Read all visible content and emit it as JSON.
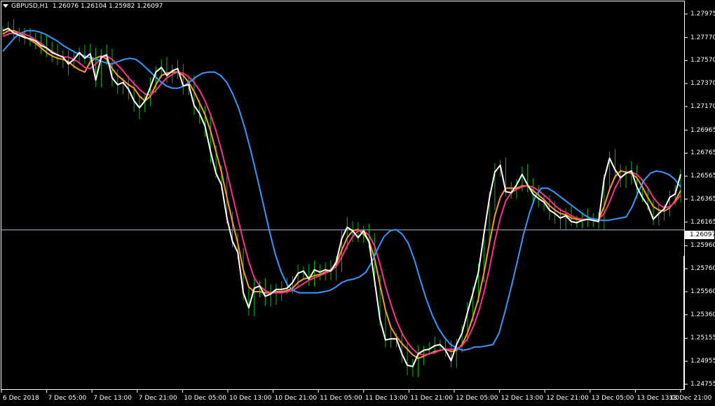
{
  "header": {
    "symbol": "GBPUSD,H1",
    "open": "1.26076",
    "high": "1.26104",
    "low": "1.25982",
    "close": "1.26097"
  },
  "current_price_label": "1.26097",
  "colors": {
    "background": "#000000",
    "grid_frame": "#ffffff",
    "bars": "#00c000",
    "price_line": "#ffffff",
    "ma_orange": "#ff9a1a",
    "ma_pink": "#ff2f8e",
    "ma_blue": "#3399ff",
    "bid_line": "#b0c4de"
  },
  "y_axis_ticks": [
    "1.27975",
    "1.27770",
    "1.27570",
    "1.27370",
    "1.27170",
    "1.26965",
    "1.26765",
    "1.26565",
    "1.26365",
    "1.26165",
    "1.25960",
    "1.25760",
    "1.25560",
    "1.25360",
    "1.25155",
    "1.24955",
    "1.24755"
  ],
  "x_axis_ticks": [
    "6 Dec 2018",
    "7 Dec 05:00",
    "7 Dec 13:00",
    "7 Dec 21:00",
    "10 Dec 05:00",
    "10 Dec 13:00",
    "10 Dec 21:00",
    "11 Dec 05:00",
    "11 Dec 13:00",
    "11 Dec 21:00",
    "12 Dec 05:00",
    "12 Dec 13:00",
    "12 Dec 21:00",
    "13 Dec 05:00",
    "13 Dec 13:00",
    "13 Dec 21:00"
  ],
  "chart_data": {
    "type": "line",
    "title": "GBPUSD,H1",
    "ylim": [
      1.247,
      1.2806
    ],
    "current_price": 1.26097,
    "series": [
      {
        "values": [
          1.2783,
          1.2785,
          1.2781,
          1.2779,
          1.2777,
          1.2776,
          1.2774,
          1.277,
          1.2768,
          1.2764,
          1.2762,
          1.276,
          1.2754,
          1.2758,
          1.2764,
          1.2759,
          1.2763,
          1.274,
          1.276,
          1.2762,
          1.2742,
          1.2736,
          1.2738,
          1.2732,
          1.2722,
          1.2716,
          1.2722,
          1.2734,
          1.2747,
          1.2751,
          1.2744,
          1.2748,
          1.275,
          1.2735,
          1.2736,
          1.2718,
          1.2711,
          1.27,
          1.2678,
          1.2659,
          1.2649,
          1.262,
          1.26,
          1.259,
          1.2555,
          1.2542,
          1.2559,
          1.2561,
          1.2552,
          1.2554,
          1.2558,
          1.2558,
          1.2559,
          1.2564,
          1.2572,
          1.2574,
          1.2567,
          1.2575,
          1.2573,
          1.2575,
          1.2574,
          1.2582,
          1.2602,
          1.2612,
          1.2609,
          1.2603,
          1.2609,
          1.2599,
          1.2566,
          1.2532,
          1.2514,
          1.2515,
          1.2515,
          1.2502,
          1.2492,
          1.2491,
          1.2502,
          1.2505,
          1.2506,
          1.2509,
          1.251,
          1.2505,
          1.2496,
          1.251,
          1.252,
          1.2538,
          1.2555,
          1.2573,
          1.2606,
          1.2637,
          1.266,
          1.2666,
          1.2643,
          1.2642,
          1.2649,
          1.2658,
          1.2649,
          1.2641,
          1.2637,
          1.2634,
          1.2627,
          1.2624,
          1.262,
          1.2622,
          1.2617,
          1.2616,
          1.2618,
          1.2619,
          1.2618,
          1.2617,
          1.2654,
          1.2672,
          1.2662,
          1.2655,
          1.2659,
          1.2661,
          1.2647,
          1.2638,
          1.2631,
          1.2619,
          1.2624,
          1.2628,
          1.2638,
          1.2641,
          1.2658
        ]
      },
      {
        "values": [
          1.278,
          1.2783,
          1.2783,
          1.2781,
          1.2778,
          1.2775,
          1.2772,
          1.2768,
          1.2764,
          1.2761,
          1.2759,
          1.2758,
          1.2756,
          1.2752,
          1.2749,
          1.2747,
          1.2756,
          1.2759,
          1.2761,
          1.2758,
          1.275,
          1.2744,
          1.274,
          1.2736,
          1.2733,
          1.2726,
          1.2722,
          1.2726,
          1.2736,
          1.2744,
          1.2746,
          1.2747,
          1.2747,
          1.2744,
          1.2738,
          1.273,
          1.272,
          1.271,
          1.2696,
          1.2678,
          1.266,
          1.2638,
          1.2617,
          1.2598,
          1.2575,
          1.256,
          1.2556,
          1.2556,
          1.2555,
          1.2555,
          1.2556,
          1.2556,
          1.2557,
          1.2559,
          1.2564,
          1.2567,
          1.2568,
          1.257,
          1.2571,
          1.2573,
          1.2575,
          1.258,
          1.2592,
          1.2603,
          1.2609,
          1.261,
          1.2606,
          1.26,
          1.2585,
          1.2562,
          1.254,
          1.2525,
          1.2517,
          1.2511,
          1.2506,
          1.2501,
          1.2498,
          1.25,
          1.2502,
          1.2504,
          1.2505,
          1.2506,
          1.2504,
          1.2505,
          1.251,
          1.252,
          1.2534,
          1.255,
          1.2572,
          1.2598,
          1.2622,
          1.2638,
          1.2646,
          1.2646,
          1.2646,
          1.2648,
          1.2648,
          1.2644,
          1.264,
          1.2636,
          1.2631,
          1.2627,
          1.2624,
          1.2623,
          1.262,
          1.2619,
          1.2618,
          1.2619,
          1.2619,
          1.2619,
          1.263,
          1.2645,
          1.2656,
          1.2661,
          1.266,
          1.2659,
          1.2655,
          1.2647,
          1.2638,
          1.263,
          1.2627,
          1.2626,
          1.2629,
          1.2635,
          1.2644
        ]
      },
      {
        "values": [
          1.2778,
          1.278,
          1.2781,
          1.2781,
          1.278,
          1.2778,
          1.2775,
          1.2772,
          1.2768,
          1.2765,
          1.2762,
          1.276,
          1.276,
          1.2758,
          1.2755,
          1.2751,
          1.275,
          1.2754,
          1.2759,
          1.2761,
          1.2758,
          1.2753,
          1.2748,
          1.2742,
          1.2737,
          1.2732,
          1.2728,
          1.2727,
          1.2731,
          1.2737,
          1.2742,
          1.2745,
          1.2747,
          1.2746,
          1.2743,
          1.2738,
          1.2731,
          1.2722,
          1.271,
          1.2696,
          1.2679,
          1.266,
          1.264,
          1.262,
          1.26,
          1.2582,
          1.2568,
          1.2561,
          1.2557,
          1.2555,
          1.2555,
          1.2555,
          1.2556,
          1.2557,
          1.256,
          1.2563,
          1.2566,
          1.2568,
          1.257,
          1.2572,
          1.2574,
          1.2578,
          1.2586,
          1.2596,
          1.2604,
          1.2609,
          1.2609,
          1.2605,
          1.2596,
          1.258,
          1.2561,
          1.2545,
          1.2531,
          1.252,
          1.2512,
          1.2506,
          1.2502,
          1.2501,
          1.2502,
          1.2503,
          1.2505,
          1.2506,
          1.2506,
          1.2506,
          1.2509,
          1.2515,
          1.2525,
          1.2538,
          1.2555,
          1.2576,
          1.26,
          1.262,
          1.2635,
          1.2642,
          1.2645,
          1.2647,
          1.2648,
          1.2647,
          1.2644,
          1.264,
          1.2636,
          1.2631,
          1.2627,
          1.2625,
          1.2622,
          1.262,
          1.2619,
          1.2619,
          1.2619,
          1.2619,
          1.2624,
          1.2634,
          1.2646,
          1.2655,
          1.2659,
          1.266,
          1.2658,
          1.2653,
          1.2646,
          1.2638,
          1.2632,
          1.2629,
          1.263,
          1.2634,
          1.264
        ]
      },
      {
        "values": [
          1.2765,
          1.2771,
          1.2777,
          1.2781,
          1.2783,
          1.2783,
          1.2782,
          1.278,
          1.2777,
          1.2774,
          1.277,
          1.2767,
          1.2764,
          1.2762,
          1.276,
          1.2759,
          1.2757,
          1.2755,
          1.2754,
          1.2756,
          1.2758,
          1.2759,
          1.2758,
          1.2754,
          1.2749,
          1.2744,
          1.2739,
          1.2735,
          1.2733,
          1.2733,
          1.2735,
          1.2739,
          1.2743,
          1.2746,
          1.2747,
          1.2747,
          1.2744,
          1.2738,
          1.2728,
          1.2715,
          1.2698,
          1.2678,
          1.2656,
          1.2633,
          1.261,
          1.2589,
          1.2573,
          1.2562,
          1.2557,
          1.2555,
          1.2555,
          1.2555,
          1.2555,
          1.2556,
          1.2557,
          1.256,
          1.2564,
          1.2566,
          1.2567,
          1.2569,
          1.2573,
          1.2582,
          1.2594,
          1.2604,
          1.2609,
          1.261,
          1.2606,
          1.2598,
          1.2584,
          1.2566,
          1.2549,
          1.2535,
          1.2524,
          1.2516,
          1.251,
          1.2507,
          1.2505,
          1.2506,
          1.2508,
          1.2508,
          1.2509,
          1.251,
          1.252,
          1.2539,
          1.256,
          1.2582,
          1.2605,
          1.2624,
          1.2639,
          1.2646,
          1.2646,
          1.2643,
          1.2639,
          1.2635,
          1.2631,
          1.2627,
          1.2623,
          1.262,
          1.2619,
          1.2618,
          1.2618,
          1.2619,
          1.262,
          1.2621,
          1.263,
          1.2643,
          1.2653,
          1.2659,
          1.2661,
          1.266,
          1.2658,
          1.2654,
          1.2647
        ]
      }
    ]
  }
}
